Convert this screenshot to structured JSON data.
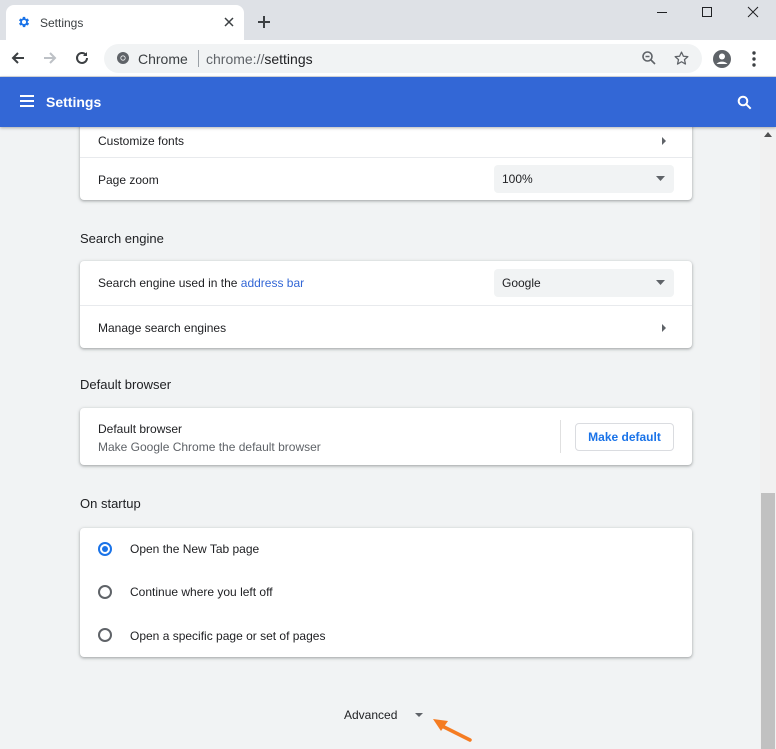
{
  "browser": {
    "tab_title": "Settings",
    "omnibox_chip": "Chrome",
    "url_scheme": "chrome://",
    "url_host": "settings"
  },
  "appbar": {
    "title": "Settings"
  },
  "appearance": {
    "customize_fonts": "Customize fonts",
    "page_zoom_label": "Page zoom",
    "page_zoom_value": "100%"
  },
  "search_engine": {
    "section_title": "Search engine",
    "used_in_prefix": "Search engine used in the ",
    "used_in_link": "address bar",
    "engine_value": "Google",
    "manage": "Manage search engines"
  },
  "default_browser": {
    "section_title": "Default browser",
    "label": "Default browser",
    "sublabel": "Make Google Chrome the default browser",
    "button": "Make default"
  },
  "on_startup": {
    "section_title": "On startup",
    "options": [
      {
        "label": "Open the New Tab page",
        "selected": true
      },
      {
        "label": "Continue where you left off",
        "selected": false
      },
      {
        "label": "Open a specific page or set of pages",
        "selected": false
      }
    ]
  },
  "advanced": {
    "label": "Advanced"
  },
  "colors": {
    "accent": "#3367d6",
    "annotation": "#f57c22"
  }
}
